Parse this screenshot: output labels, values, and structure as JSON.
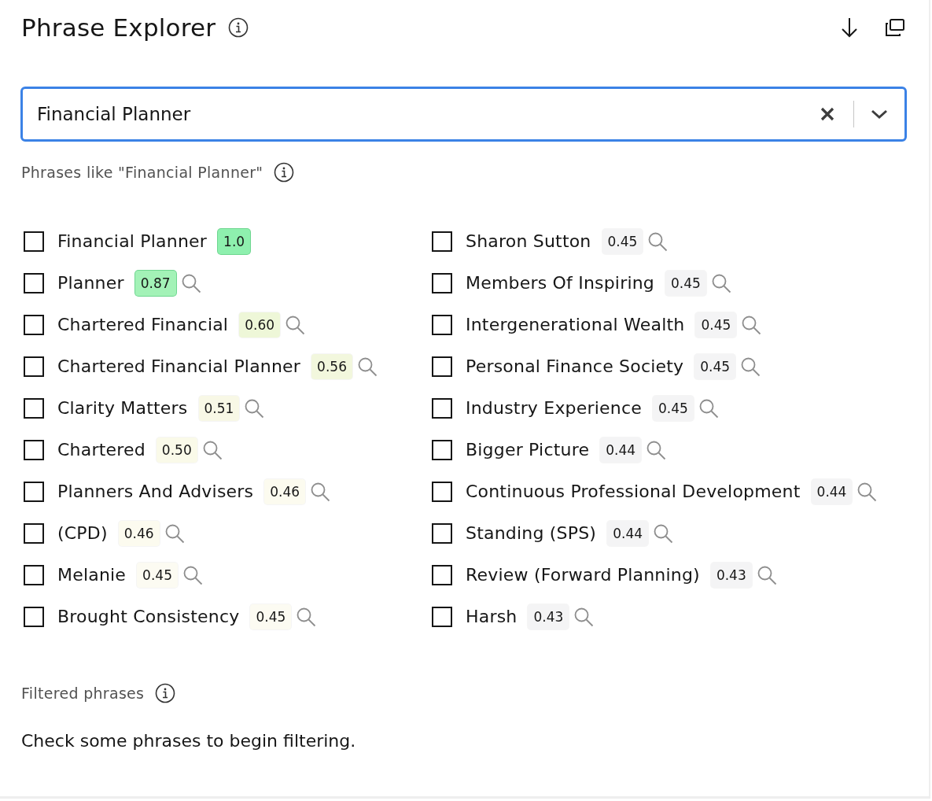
{
  "header": {
    "title": "Phrase Explorer"
  },
  "search": {
    "value": "Financial Planner"
  },
  "similar": {
    "label": "Phrases like \"Financial Planner\"",
    "columns": [
      [
        {
          "text": "Financial Planner",
          "score": "1.0",
          "color": "#8ef0ae",
          "checked": false,
          "search_icon": false
        },
        {
          "text": "Planner",
          "score": "0.87",
          "color": "#a3f2b7",
          "checked": false,
          "search_icon": true
        },
        {
          "text": "Chartered Financial",
          "score": "0.60",
          "color": "#eef7d8",
          "checked": false,
          "search_icon": true
        },
        {
          "text": "Chartered Financial Planner",
          "score": "0.56",
          "color": "#f2f7dd",
          "checked": false,
          "search_icon": true
        },
        {
          "text": "Clarity Matters",
          "score": "0.51",
          "color": "#f8f8e6",
          "checked": false,
          "search_icon": true
        },
        {
          "text": "Chartered",
          "score": "0.50",
          "color": "#fafae9",
          "checked": false,
          "search_icon": true
        },
        {
          "text": "Planners And Advisers",
          "score": "0.46",
          "color": "#fcfbef",
          "checked": false,
          "search_icon": true
        },
        {
          "text": "(CPD)",
          "score": "0.46",
          "color": "#fcfbef",
          "checked": false,
          "search_icon": true
        },
        {
          "text": "Melanie",
          "score": "0.45",
          "color": "#fcfbf2",
          "checked": false,
          "search_icon": true
        },
        {
          "text": "Brought Consistency",
          "score": "0.45",
          "color": "#fcfbf2",
          "checked": false,
          "search_icon": true
        }
      ],
      [
        {
          "text": "Sharon Sutton",
          "score": "0.45",
          "color": "#f4f4f5",
          "checked": false,
          "search_icon": true
        },
        {
          "text": "Members Of Inspiring",
          "score": "0.45",
          "color": "#f4f4f5",
          "checked": false,
          "search_icon": true
        },
        {
          "text": "Intergenerational Wealth",
          "score": "0.45",
          "color": "#f4f4f5",
          "checked": false,
          "search_icon": true
        },
        {
          "text": "Personal Finance Society",
          "score": "0.45",
          "color": "#f4f4f5",
          "checked": false,
          "search_icon": true
        },
        {
          "text": "Industry Experience",
          "score": "0.45",
          "color": "#f4f4f5",
          "checked": false,
          "search_icon": true
        },
        {
          "text": "Bigger Picture",
          "score": "0.44",
          "color": "#f4f4f5",
          "checked": false,
          "search_icon": true
        },
        {
          "text": "Continuous Professional Development",
          "score": "0.44",
          "color": "#f4f4f5",
          "checked": false,
          "search_icon": true
        },
        {
          "text": "Standing (SPS)",
          "score": "0.44",
          "color": "#f4f4f5",
          "checked": false,
          "search_icon": true
        },
        {
          "text": "Review (Forward Planning)",
          "score": "0.43",
          "color": "#f4f4f5",
          "checked": false,
          "search_icon": true
        },
        {
          "text": "Harsh",
          "score": "0.43",
          "color": "#f4f4f5",
          "checked": false,
          "search_icon": true
        }
      ]
    ]
  },
  "filtered": {
    "label": "Filtered phrases",
    "message": "Check some phrases to begin filtering."
  }
}
